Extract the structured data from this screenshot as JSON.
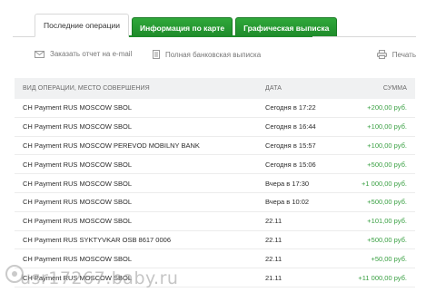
{
  "tabs": [
    {
      "label": "Последние операции",
      "active": true
    },
    {
      "label": "Информация по карте",
      "active": false
    },
    {
      "label": "Графическая выписка",
      "active": false
    }
  ],
  "actions": {
    "email_report": "Заказать отчет на e-mail",
    "full_statement": "Полная банковская выписка",
    "print": "Печать"
  },
  "table": {
    "headers": {
      "operation": "ВИД ОПЕРАЦИИ, МЕСТО СОВЕРШЕНИЯ",
      "date": "ДАТА",
      "amount": "СУММА"
    },
    "rows": [
      {
        "operation": "CH Payment RUS MOSCOW SBOL",
        "date": "Сегодня в 17:22",
        "amount": "+200,00 руб."
      },
      {
        "operation": "CH Payment RUS MOSCOW SBOL",
        "date": "Сегодня в 16:44",
        "amount": "+100,00 руб."
      },
      {
        "operation": "CH Payment RUS MOSCOW PEREVOD MOBILNY BANK",
        "date": "Сегодня в 15:57",
        "amount": "+100,00 руб."
      },
      {
        "operation": "CH Payment RUS MOSCOW SBOL",
        "date": "Сегодня в 15:06",
        "amount": "+500,00 руб."
      },
      {
        "operation": "CH Payment RUS MOSCOW SBOL",
        "date": "Вчера в 17:30",
        "amount": "+1 000,00 руб."
      },
      {
        "operation": "CH Payment RUS MOSCOW SBOL",
        "date": "Вчера в 10:02",
        "amount": "+500,00 руб."
      },
      {
        "operation": "CH Payment RUS MOSCOW SBOL",
        "date": "22.11",
        "amount": "+101,00 руб."
      },
      {
        "operation": "CH Payment RUS SYKTYVKAR OSB 8617 0006",
        "date": "22.11",
        "amount": "+500,00 руб."
      },
      {
        "operation": "CH Payment RUS MOSCOW SBOL",
        "date": "22.11",
        "amount": "+50,00 руб."
      },
      {
        "operation": "CH Payment RUS MOSCOW SBOL",
        "date": "21.11",
        "amount": "+11 000,00 руб."
      }
    ]
  },
  "watermark": "usr17267.baby.ru",
  "colors": {
    "tab_green": "#1e8a2a",
    "amount_green": "#3aa043",
    "header_bg": "#f0f1f2"
  }
}
